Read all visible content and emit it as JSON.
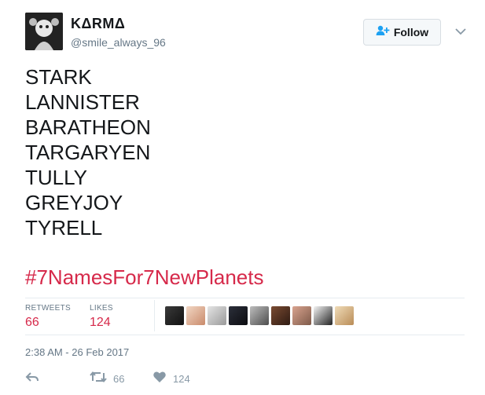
{
  "user": {
    "name": "KΔRMΔ",
    "handle": "@smile_always_96"
  },
  "follow_label": "Follow",
  "tweet": {
    "lines": [
      "STARK",
      "LANNISTER",
      "BARATHEON",
      "TARGARYEN",
      "TULLY",
      "GREYJOY",
      "TYRELL"
    ],
    "hashtag": "#7NamesFor7NewPlanets"
  },
  "stats": {
    "retweets_label": "RETWEETS",
    "retweets": "66",
    "likes_label": "LIKES",
    "likes": "124"
  },
  "likers_count_shown": 9,
  "timestamp": "2:38 AM - 26 Feb 2017",
  "actions": {
    "retweet_count": "66",
    "like_count": "124"
  },
  "colors": {
    "accent": "#d6294a",
    "muted": "#657786",
    "icon": "#8899a6",
    "follow_icon": "#1da1f2"
  },
  "icons": [
    "user-plus-icon",
    "chevron-down-icon",
    "reply-icon",
    "retweet-icon",
    "heart-icon"
  ]
}
